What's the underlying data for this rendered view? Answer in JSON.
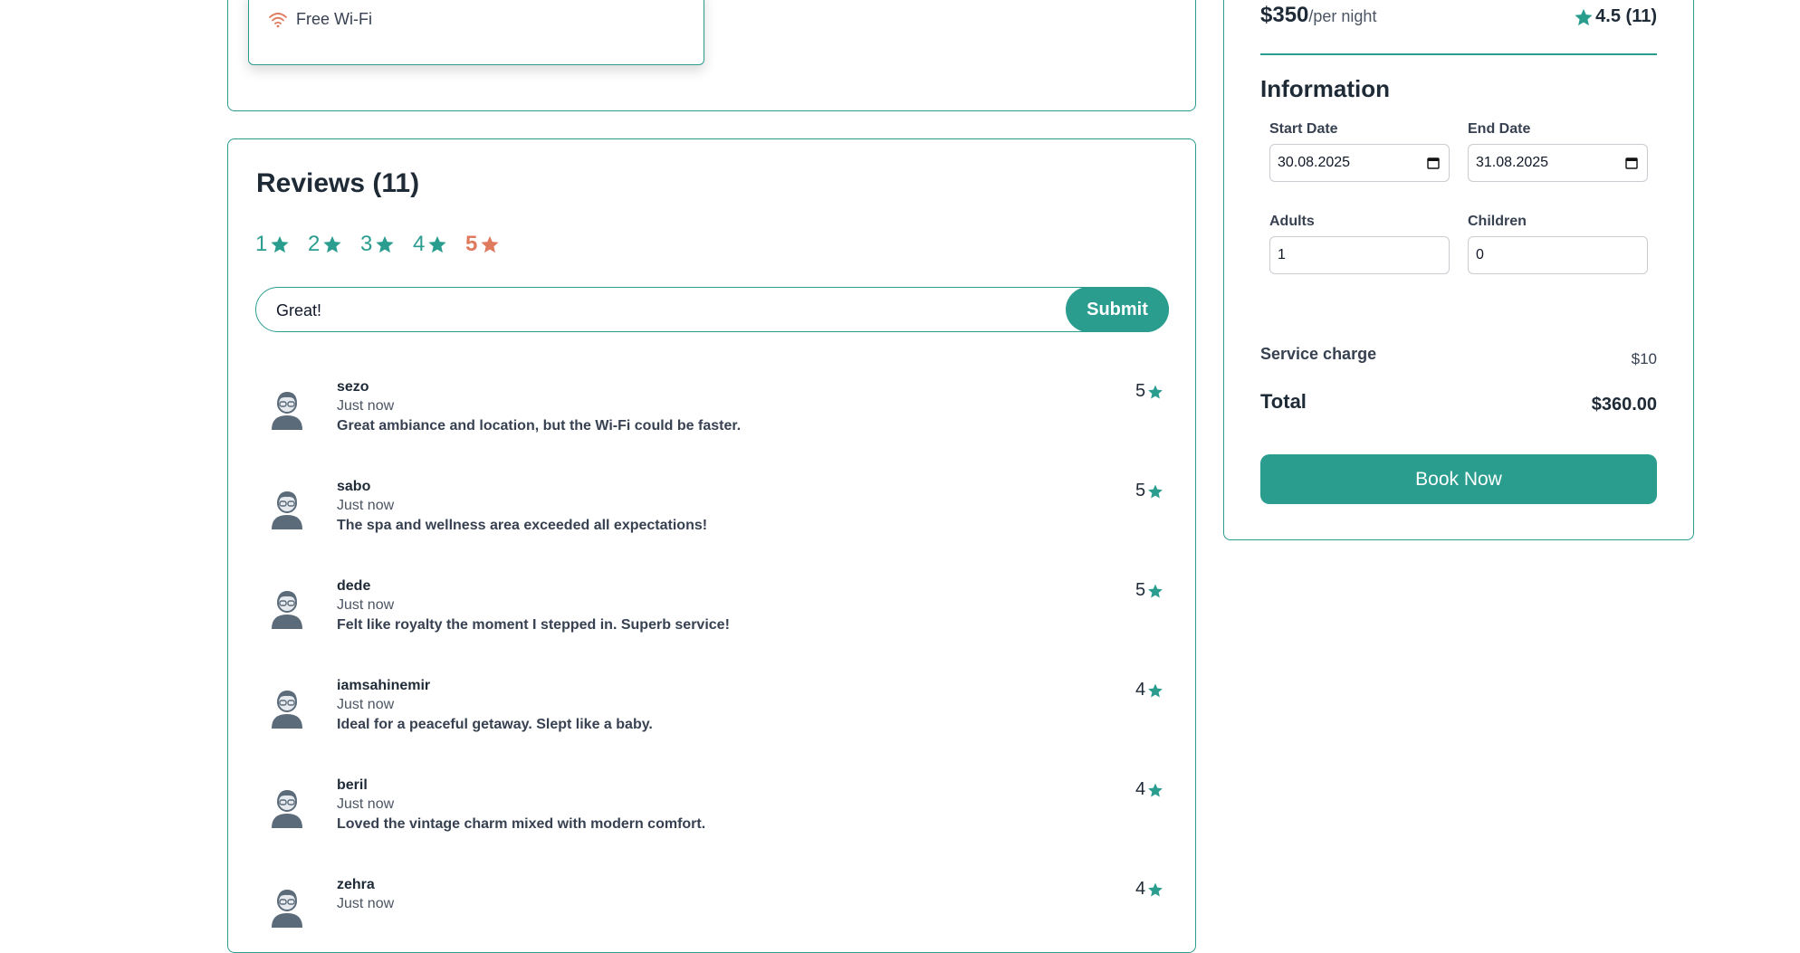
{
  "amenities": {
    "wifi_label": "Free Wi-Fi"
  },
  "reviews": {
    "title": "Reviews (11)",
    "filters": [
      {
        "label": "1",
        "active": false
      },
      {
        "label": "2",
        "active": false
      },
      {
        "label": "3",
        "active": false
      },
      {
        "label": "4",
        "active": false
      },
      {
        "label": "5",
        "active": true
      }
    ],
    "input_value": "Great!",
    "submit_label": "Submit",
    "items": [
      {
        "name": "sezo",
        "time": "Just now",
        "text": "Great ambiance and location, but the Wi-Fi could be faster.",
        "rating": "5"
      },
      {
        "name": "sabo",
        "time": "Just now",
        "text": "The spa and wellness area exceeded all expectations!",
        "rating": "5"
      },
      {
        "name": "dede",
        "time": "Just now",
        "text": "Felt like royalty the moment I stepped in. Superb service!",
        "rating": "5"
      },
      {
        "name": "iamsahinemir",
        "time": "Just now",
        "text": "Ideal for a peaceful getaway. Slept like a baby.",
        "rating": "4"
      },
      {
        "name": "beril",
        "time": "Just now",
        "text": "Loved the vintage charm mixed with modern comfort.",
        "rating": "4"
      },
      {
        "name": "zehra",
        "time": "Just now",
        "text": "",
        "rating": "4"
      }
    ]
  },
  "booking": {
    "price": "$350",
    "price_unit": "/per night",
    "rating": "4.5 (11)",
    "info_title": "Information",
    "start_date_label": "Start Date",
    "start_date_value": "30.08.2025",
    "end_date_label": "End Date",
    "end_date_value": "31.08.2025",
    "adults_label": "Adults",
    "adults_value": "1",
    "children_label": "Children",
    "children_value": "0",
    "service_charge_label": "Service charge",
    "service_charge_value": "$10",
    "total_label": "Total",
    "total_value": "$360.00",
    "book_label": "Book Now"
  },
  "colors": {
    "accent": "#2a9d8f",
    "highlight": "#e07a5f"
  },
  "icons": {
    "wifi": "wifi-icon",
    "star": "star-icon",
    "avatar": "avatar-icon",
    "calendar": "calendar-icon"
  }
}
